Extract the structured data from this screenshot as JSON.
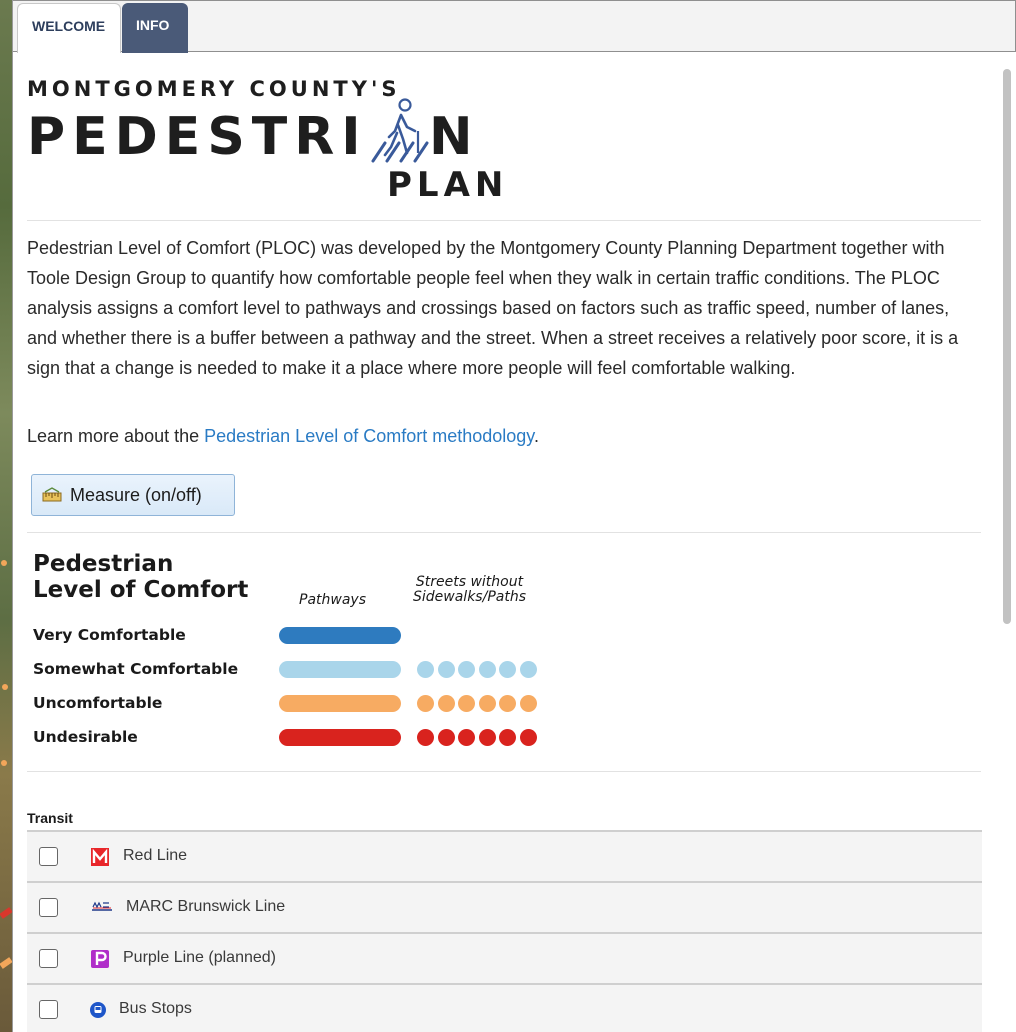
{
  "tabs": [
    {
      "label": "WELCOME",
      "active": true
    },
    {
      "label": "INFO",
      "active": false
    }
  ],
  "logo": {
    "top_line": "MONTGOMERY COUNTY'S",
    "main_left": "PEDESTRI",
    "main_right": "N",
    "sub": "PLAN"
  },
  "description": "Pedestrian Level of Comfort (PLOC) was developed by the Montgomery County Planning Department together with Toole Design Group to quantify how comfortable people feel when they walk in certain traffic conditions. The PLOC analysis assigns a comfort level to pathways and crossings based on factors such as traffic speed, number of lanes, and whether there is a buffer between a pathway and the street. When a street receives a relatively poor score, it is a sign that a change is needed to make it a place where more people will feel comfortable walking.",
  "learn_more": {
    "prefix": "Learn more about the ",
    "link_text": "Pedestrian Level of Comfort methodology",
    "suffix": "."
  },
  "measure_button": "Measure (on/off)",
  "legend": {
    "title_line1": "Pedestrian",
    "title_line2": "Level of Comfort",
    "col_pathways": "Pathways",
    "col_streets_line1": "Streets without",
    "col_streets_line2": "Sidewalks/Paths",
    "rows": [
      {
        "label": "Very Comfortable",
        "color": "#2e7bbf",
        "has_dots": false
      },
      {
        "label": "Somewhat Comfortable",
        "color": "#a9d5ea",
        "has_dots": true
      },
      {
        "label": "Uncomfortable",
        "color": "#f7ab62",
        "has_dots": true
      },
      {
        "label": "Undesirable",
        "color": "#d9231e",
        "has_dots": true
      }
    ]
  },
  "transit": {
    "heading": "Transit",
    "items": [
      {
        "label": "Red Line",
        "icon": "metro-m-icon",
        "checked": false
      },
      {
        "label": "MARC Brunswick Line",
        "icon": "marc-icon",
        "checked": false
      },
      {
        "label": "Purple Line (planned)",
        "icon": "purple-line-icon",
        "checked": false
      },
      {
        "label": "Bus Stops",
        "icon": "bus-stop-icon",
        "checked": false
      }
    ]
  }
}
